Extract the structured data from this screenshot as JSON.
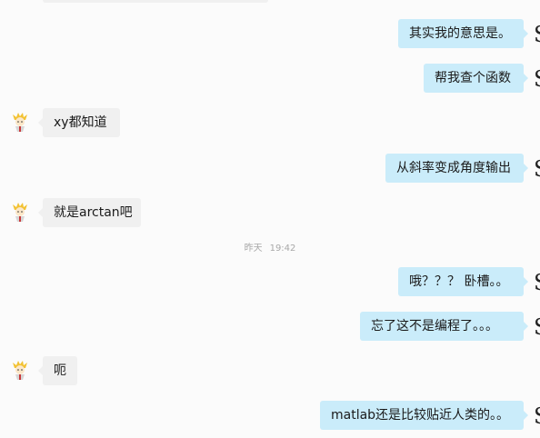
{
  "conversation": {
    "timestamp": {
      "day": "昨天",
      "time": "19:42"
    },
    "self_avatar_glyph": "S",
    "messages": [
      {
        "text": "其实我的意思是。",
        "from": "self"
      },
      {
        "text": "帮我查个函数",
        "from": "self"
      },
      {
        "text": "xy都知道",
        "from": "peer"
      },
      {
        "text": "从斜率变成角度输出",
        "from": "self"
      },
      {
        "text": "就是arctan吧",
        "from": "peer"
      },
      {
        "text": "哦？？？ 卧槽。。",
        "from": "self"
      },
      {
        "text": "忘了这不是编程了。。。",
        "from": "self"
      },
      {
        "text": "呃",
        "from": "peer"
      },
      {
        "text": "matlab还是比较贴近人类的。。",
        "from": "self"
      }
    ]
  },
  "colors": {
    "self_bubble": "#caecfa",
    "peer_bubble": "#f0f0f0",
    "background": "#fbfbfb",
    "timestamp_text": "#a8a8a8"
  }
}
